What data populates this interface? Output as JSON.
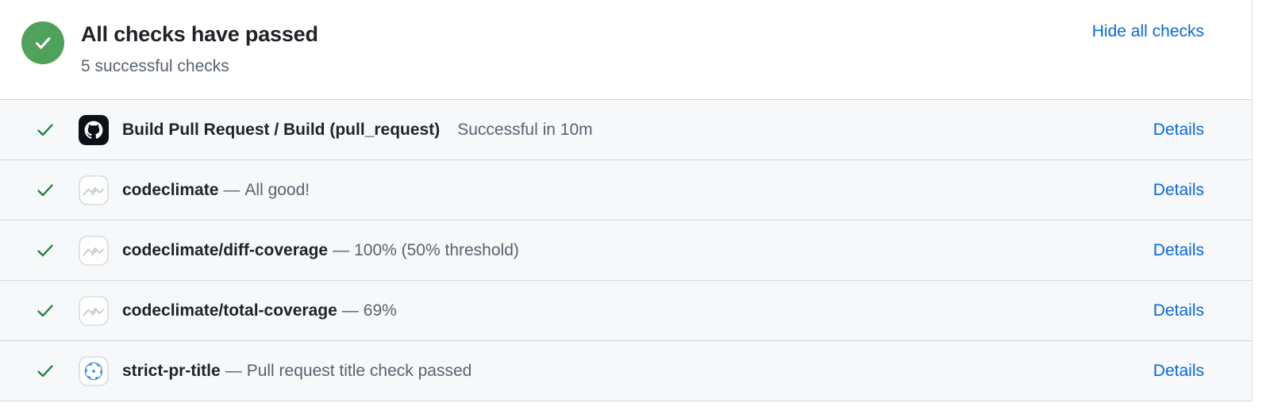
{
  "colors": {
    "success_green": "#4fa25a",
    "check_green": "#1a7f37",
    "link_blue": "#0969da",
    "row_bg": "#f6f8fa",
    "border": "#d0d7de",
    "muted_text": "#59636e",
    "strong_text": "#1f2328"
  },
  "header": {
    "status_icon": "check-circle-icon",
    "title": "All checks have passed",
    "subtitle": "5 successful checks",
    "hide_all_label": "Hide all checks"
  },
  "checks": [
    {
      "status_icon": "check-icon",
      "avatar_icon": "github-actions-octocat-icon",
      "name": "Build Pull Request / Build (pull_request)",
      "separator": "",
      "description": "",
      "meta": "Successful in 10m",
      "details_label": "Details"
    },
    {
      "status_icon": "check-icon",
      "avatar_icon": "codeclimate-icon",
      "name": "codeclimate",
      "separator": "—",
      "description": "All good!",
      "meta": "",
      "details_label": "Details"
    },
    {
      "status_icon": "check-icon",
      "avatar_icon": "codeclimate-icon",
      "name": "codeclimate/diff-coverage",
      "separator": "—",
      "description": "100% (50% threshold)",
      "meta": "",
      "details_label": "Details"
    },
    {
      "status_icon": "check-icon",
      "avatar_icon": "codeclimate-icon",
      "name": "codeclimate/total-coverage",
      "separator": "—",
      "description": "69%",
      "meta": "",
      "details_label": "Details"
    },
    {
      "status_icon": "check-icon",
      "avatar_icon": "strict-pr-title-pinwheel-icon",
      "name": "strict-pr-title",
      "separator": "—",
      "description": "Pull request title check passed",
      "meta": "",
      "details_label": "Details"
    }
  ]
}
